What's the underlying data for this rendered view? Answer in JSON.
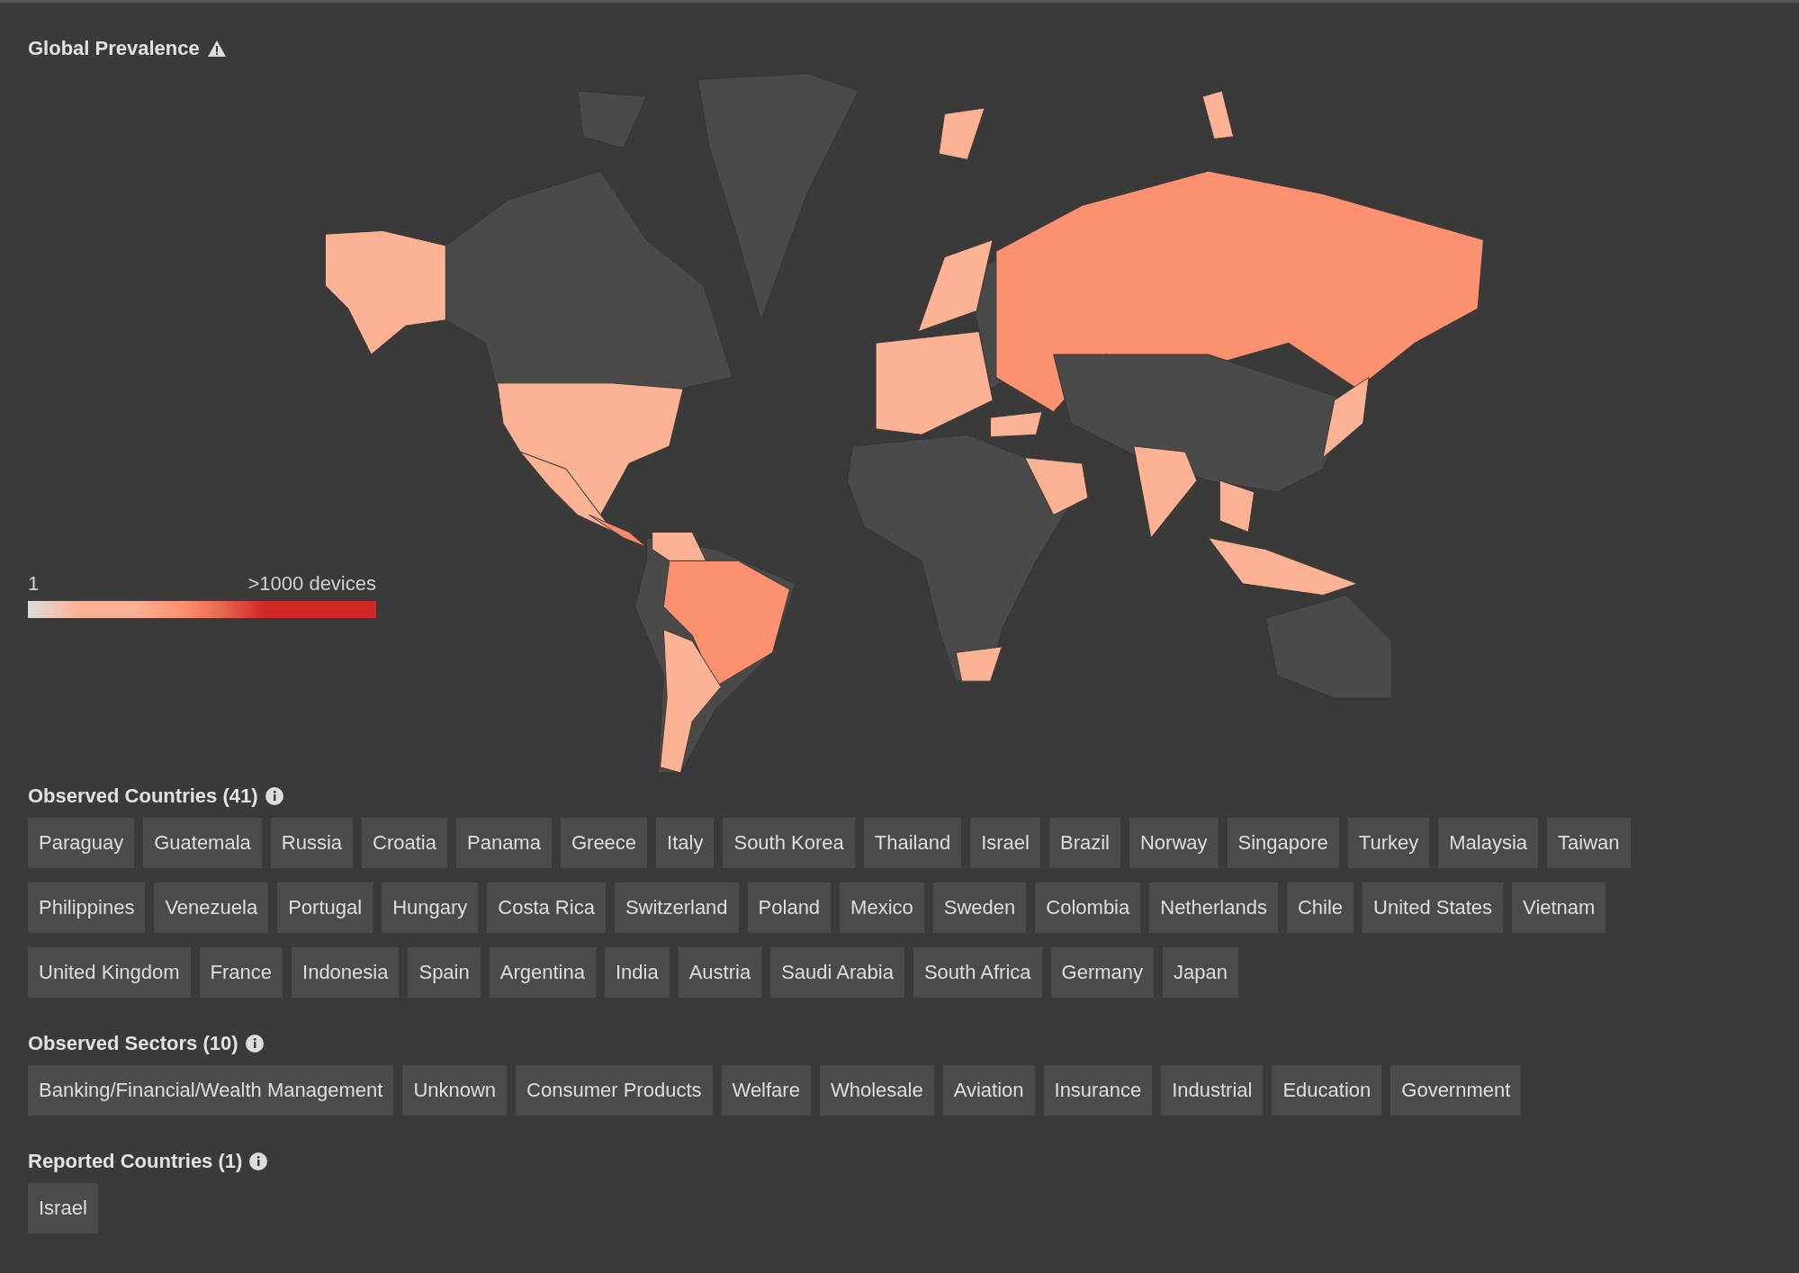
{
  "title": "Global Prevalence",
  "legend": {
    "min_label": "1",
    "max_label": ">1000 devices"
  },
  "sections": [
    {
      "heading": "Observed Countries (41)",
      "tags": [
        "Paraguay",
        "Guatemala",
        "Russia",
        "Croatia",
        "Panama",
        "Greece",
        "Italy",
        "South Korea",
        "Thailand",
        "Israel",
        "Brazil",
        "Norway",
        "Singapore",
        "Turkey",
        "Malaysia",
        "Taiwan",
        "Philippines",
        "Venezuela",
        "Portugal",
        "Hungary",
        "Costa Rica",
        "Switzerland",
        "Poland",
        "Mexico",
        "Sweden",
        "Colombia",
        "Netherlands",
        "Chile",
        "United States",
        "Vietnam",
        "United Kingdom",
        "France",
        "Indonesia",
        "Spain",
        "Argentina",
        "India",
        "Austria",
        "Saudi Arabia",
        "South Africa",
        "Germany",
        "Japan"
      ]
    },
    {
      "heading": "Observed Sectors (10)",
      "tags": [
        "Banking/Financial/Wealth Management",
        "Unknown",
        "Consumer Products",
        "Welfare",
        "Wholesale",
        "Aviation",
        "Insurance",
        "Industrial",
        "Education",
        "Government"
      ]
    },
    {
      "heading": "Reported Countries (1)",
      "tags": [
        "Israel"
      ]
    }
  ]
}
